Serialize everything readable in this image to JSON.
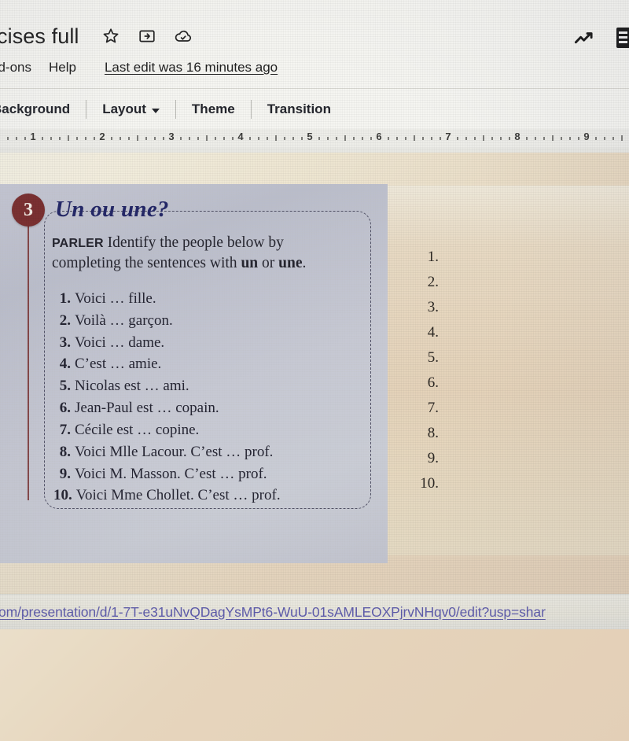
{
  "app": {
    "doc_title": "cises full",
    "title_icons": [
      "star-icon",
      "move-to-folder-icon",
      "cloud-done-icon"
    ],
    "menu": {
      "addons": "dd-ons",
      "help": "Help",
      "last_edit": "Last edit was 16 minutes ago"
    },
    "top_right": {
      "trending_icon": "trending-up-icon",
      "edge_button_icon": "menu-icon"
    }
  },
  "toolbar": {
    "background": "Background",
    "layout": "Layout",
    "theme": "Theme",
    "transition": "Transition"
  },
  "ruler": {
    "numbers": [
      "1",
      "2",
      "3",
      "4",
      "5",
      "6",
      "7",
      "8",
      "9"
    ]
  },
  "worksheet": {
    "badge_number": "3",
    "title": "Un ou une?",
    "instruction_label": "PARLER",
    "instruction_line1": "Identify the people below by",
    "instruction_line2_pre": "completing the sentences with ",
    "instruction_word1": "un",
    "instruction_line2_mid": " or ",
    "instruction_word2": "une",
    "instruction_line2_end": ".",
    "items": [
      {
        "n": "1.",
        "text": "Voici … fille."
      },
      {
        "n": "2.",
        "text": "Voilà … garçon."
      },
      {
        "n": "3.",
        "text": "Voici … dame."
      },
      {
        "n": "4.",
        "text": "C’est … amie."
      },
      {
        "n": "5.",
        "text": "Nicolas est … ami."
      },
      {
        "n": "6.",
        "text": "Jean-Paul est … copain."
      },
      {
        "n": "7.",
        "text": "Cécile est … copine."
      },
      {
        "n": "8.",
        "text": "Voici Mlle Lacour. C’est … prof."
      },
      {
        "n": "9.",
        "text": "Voici M. Masson. C’est … prof."
      },
      {
        "n": "10.",
        "text": "Voici Mme Chollet. C’est … prof."
      }
    ]
  },
  "answer_column": {
    "items": [
      "1.",
      "2.",
      "3.",
      "4.",
      "5.",
      "6.",
      "7.",
      "8.",
      "9.",
      "10."
    ]
  },
  "url_bar": {
    "url": "om/presentation/d/1-7T-e31uNvQDagYsMPt6-WuU-01sAMLEOXPjrvNHqv0/edit?usp=shar"
  },
  "colors": {
    "badge": "#7e2b2c",
    "title_blue": "#20256b",
    "link_purple": "#5b58b3",
    "chrome": "#f6f6f2"
  }
}
